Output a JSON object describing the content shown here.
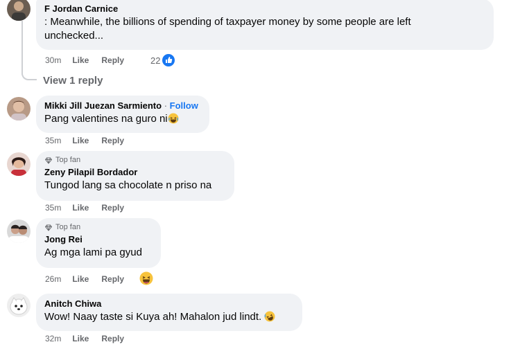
{
  "comments": [
    {
      "author": "F Jordan Carnice",
      "text": ": Meanwhile, the billions of spending of taxpayer money by some people are left unchecked...",
      "time": "30m",
      "like": "Like",
      "reply": "Reply",
      "reaction_count": "22",
      "reaction_icon": "like-icon"
    },
    {
      "author": "Mikki Jill Juezan Sarmiento",
      "separator": "·",
      "follow": "Follow",
      "text": "Pang valentines na guro ni",
      "emoji": "laughing-emoji-icon",
      "time": "35m",
      "like": "Like",
      "reply": "Reply"
    },
    {
      "badge": "Top fan",
      "author": "Zeny Pilapil Bordador",
      "text": "Tungod lang sa chocolate n priso na",
      "time": "35m",
      "like": "Like",
      "reply": "Reply"
    },
    {
      "badge": "Top fan",
      "author": "Jong Rei",
      "text": "Ag mga lami pa gyud",
      "time": "26m",
      "like": "Like",
      "reply": "Reply",
      "reaction_icon": "haha-reaction-icon"
    },
    {
      "author": "Anitch Chiwa",
      "text": "Wow! Naay taste si Kuya ah! Mahalon jud lindt.",
      "emoji": "rofl-emoji-icon",
      "time": "32m",
      "like": "Like",
      "reply": "Reply"
    }
  ],
  "view_replies": "View 1 reply",
  "colors": {
    "bubble": "#f0f2f5",
    "meta": "#65676b",
    "follow": "#1877f2",
    "like_badge": "#1877f2"
  }
}
